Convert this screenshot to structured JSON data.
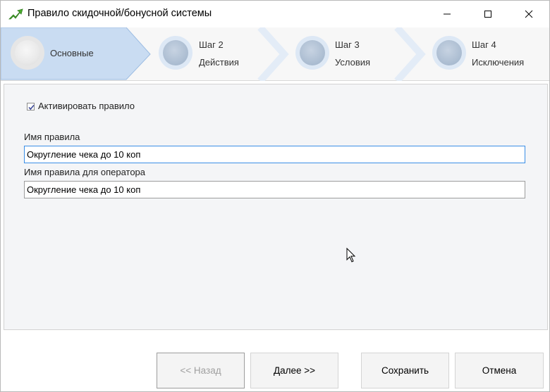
{
  "window": {
    "title": "Правило скидочной/бонусной системы",
    "icon": "green-arrow-icon"
  },
  "steps": [
    {
      "label": "Основные",
      "active": true
    },
    {
      "label": "Шаг 2",
      "sublabel": "Действия",
      "active": false
    },
    {
      "label": "Шаг 3",
      "sublabel": "Условия",
      "active": false
    },
    {
      "label": "Шаг 4",
      "sublabel": "Исключения",
      "active": false
    }
  ],
  "form": {
    "activate_label": "Активировать правило",
    "activate_checked": true,
    "rule_name_label": "Имя правила",
    "rule_name_value": "Округление чека до 10 коп",
    "operator_name_label": "Имя правила для оператора",
    "operator_name_value": "Округление чека до 10 коп"
  },
  "buttons": {
    "back": "<< Назад",
    "next": "Далее >>",
    "save": "Сохранить",
    "cancel": "Отмена"
  },
  "colors": {
    "active_step": "#c9dcf2",
    "step_bg": "#f7f7f7",
    "content_bg": "#f4f5f7",
    "focus_border": "#3a8ee6",
    "icon_green": "#4caf2f"
  }
}
